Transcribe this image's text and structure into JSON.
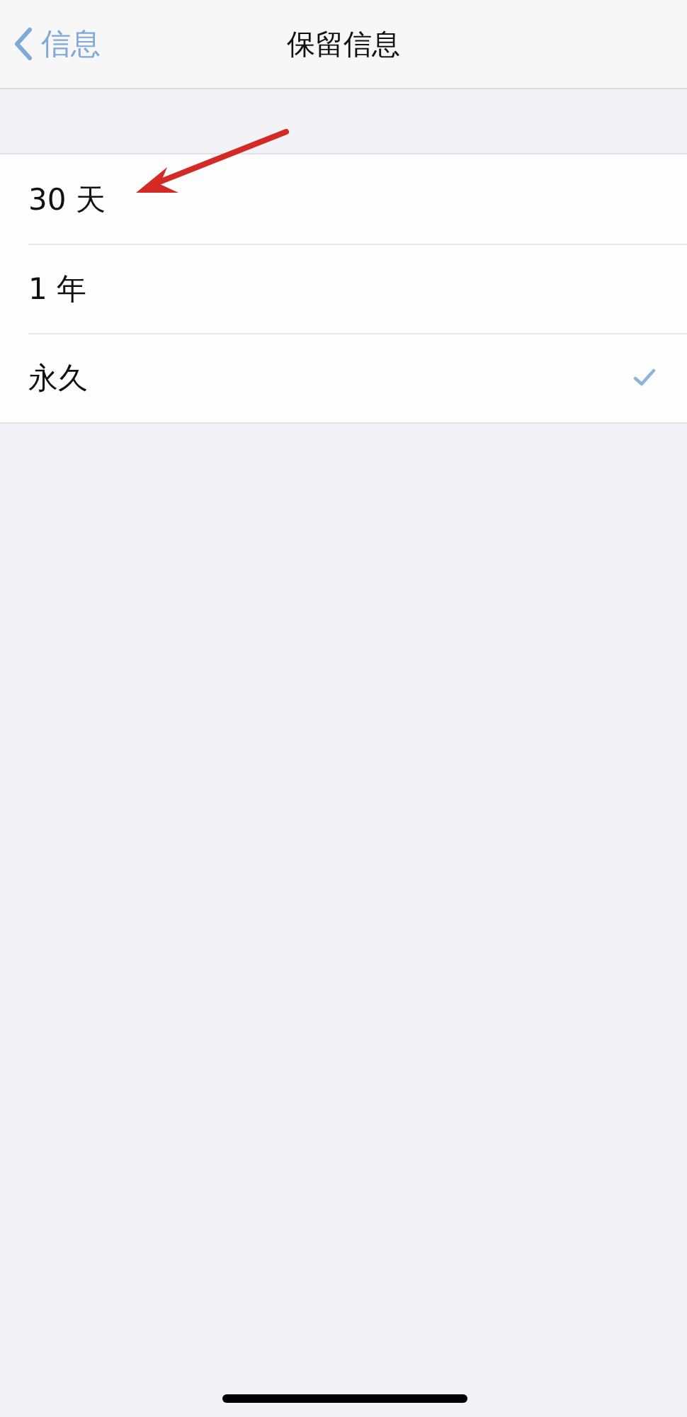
{
  "nav": {
    "back": "信息",
    "title": "保留信息"
  },
  "options": [
    {
      "label": "30 天",
      "selected": false
    },
    {
      "label": "1 年",
      "selected": false
    },
    {
      "label": "永久",
      "selected": true
    }
  ]
}
